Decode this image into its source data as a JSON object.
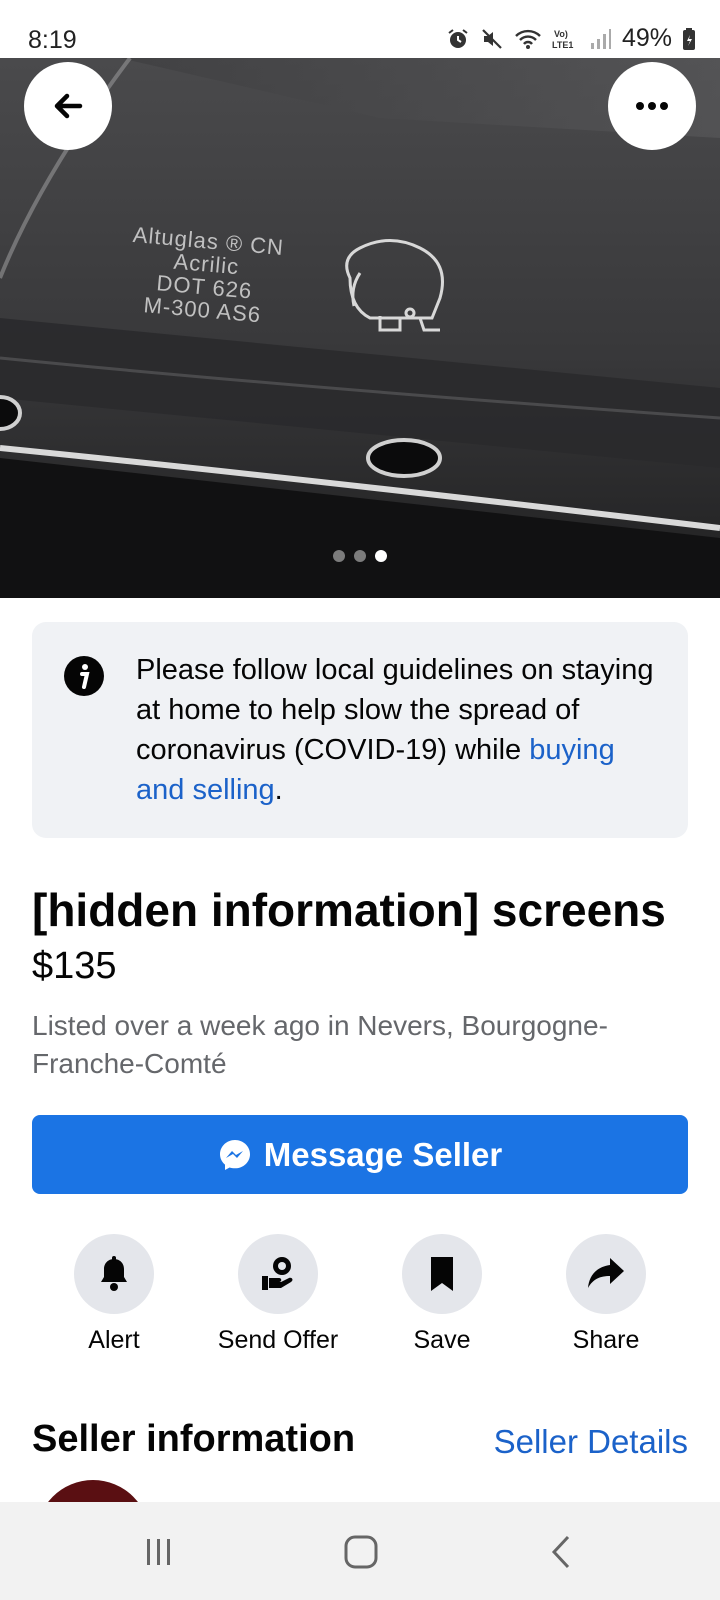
{
  "status_bar": {
    "time": "8:19",
    "battery": "49%",
    "network_label": "Vo) LTE1",
    "icons": [
      "alarm-icon",
      "mute-icon",
      "wifi-icon",
      "lte-icon",
      "signal-icon",
      "battery-icon"
    ]
  },
  "hero": {
    "engraving_text": "Altuglas ® CN\nAcrilic\nDOT 626\nM-300 AS6",
    "image_count": 3,
    "active_index": 2,
    "back_icon": "arrow-left-icon",
    "more_icon": "more-horizontal-icon"
  },
  "notice": {
    "icon": "info-icon",
    "text_before": "Please follow local guidelines on staying at home to help slow the spread of coronavirus (COVID-19) while ",
    "link_text": "buying and selling",
    "text_after": "."
  },
  "listing": {
    "title": "[hidden information] screens",
    "price": "$135",
    "meta": "Listed over a week ago in Nevers, Bourgogne-Franche-Comté"
  },
  "message_button": {
    "label": "Message Seller",
    "icon": "messenger-icon"
  },
  "actions": [
    {
      "label": "Alert",
      "icon": "bell-icon"
    },
    {
      "label": "Send Offer",
      "icon": "offer-icon"
    },
    {
      "label": "Save",
      "icon": "bookmark-icon"
    },
    {
      "label": "Share",
      "icon": "share-icon"
    }
  ],
  "seller": {
    "heading": "Seller information",
    "details_link": "Seller Details"
  },
  "nav_bar": {
    "icons": [
      "recents-icon",
      "home-icon",
      "back-icon"
    ]
  },
  "colors": {
    "accent": "#1b74e4",
    "link": "#1b62c9",
    "notice_bg": "#f0f2f5",
    "secondary_text": "#65676b"
  }
}
